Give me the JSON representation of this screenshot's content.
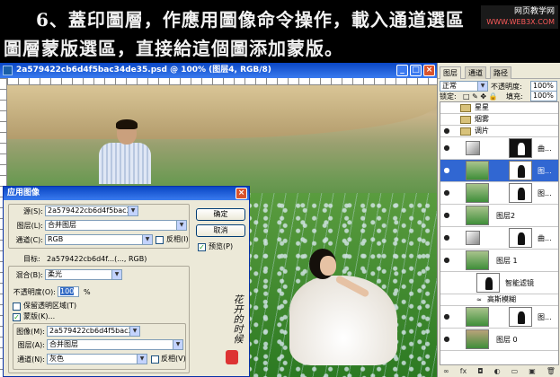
{
  "header": {
    "line1": "6、蓋印圖層，作應用圖像命令操作，載入通道選區",
    "line2": "圖層蒙版選區，直接給這個圖添加蒙版。",
    "watermark": "网页教学网",
    "watermark_url": "WWW.WEB3X.COM"
  },
  "document": {
    "title": "2a579422cb6d4f5bac34de35.psd @ 100% (图层4, RGB/8)",
    "minimize": "_",
    "maximize": "□",
    "close": "×"
  },
  "dialog": {
    "title": "应用图像",
    "close": "×",
    "source_label": "源(S):",
    "source_value": "2a579422cb6d4f5bac34...",
    "layer_label": "图层(L):",
    "layer_value": "合并图层",
    "channel_label": "通道(C):",
    "channel_value": "RGB",
    "invert_label": "反相(I)",
    "target_label": "目标:",
    "target_value": "2a579422cb6d4f...(..., RGB)",
    "blend_label": "混合(B):",
    "blend_value": "柔光",
    "opacity_label": "不透明度(O):",
    "opacity_value": "100",
    "percent": "%",
    "preserve_label": "保留透明区域(T)",
    "mask_label": "蒙版(K)...",
    "mask_image_label": "图像(M):",
    "mask_image_value": "2a579422cb6d4f5bac34...",
    "mask_layer_label": "图层(A):",
    "mask_layer_value": "合并图层",
    "mask_channel_label": "通道(N):",
    "mask_channel_value": "灰色",
    "mask_invert_label": "反相(V)",
    "ok": "确定",
    "cancel": "取消",
    "preview_label": "预览(P)",
    "check_mark": "✓"
  },
  "panel": {
    "tabs": [
      "图层",
      "通道",
      "路径"
    ],
    "blend_mode": "正常",
    "opacity_label": "不透明度:",
    "opacity_value": "100%",
    "lock_label": "锁定:",
    "fill_label": "填充:",
    "fill_value": "100%",
    "layers": [
      {
        "name": "星星",
        "type": "folder"
      },
      {
        "name": "烟雾",
        "type": "folder"
      },
      {
        "name": "调片",
        "type": "folder-open"
      },
      {
        "name": "曲...",
        "type": "adjustment"
      },
      {
        "name": "图...",
        "type": "layer-mask",
        "selected": true
      },
      {
        "name": "图...",
        "type": "layer-mask"
      },
      {
        "name": "图层2",
        "type": "layer"
      },
      {
        "name": "曲...",
        "type": "adjustment"
      },
      {
        "name": "图层 1",
        "type": "smart"
      },
      {
        "name": "智能滤镜",
        "type": "smart-filter"
      },
      {
        "name": "高斯模糊",
        "type": "filter"
      },
      {
        "name": "图...",
        "type": "layer-mask"
      },
      {
        "name": "图层 0",
        "type": "layer"
      }
    ],
    "footer": [
      "∞",
      "fx",
      "◘",
      "◐",
      "▭",
      "▣",
      "🗑"
    ]
  },
  "signature_text": "花开的时候"
}
